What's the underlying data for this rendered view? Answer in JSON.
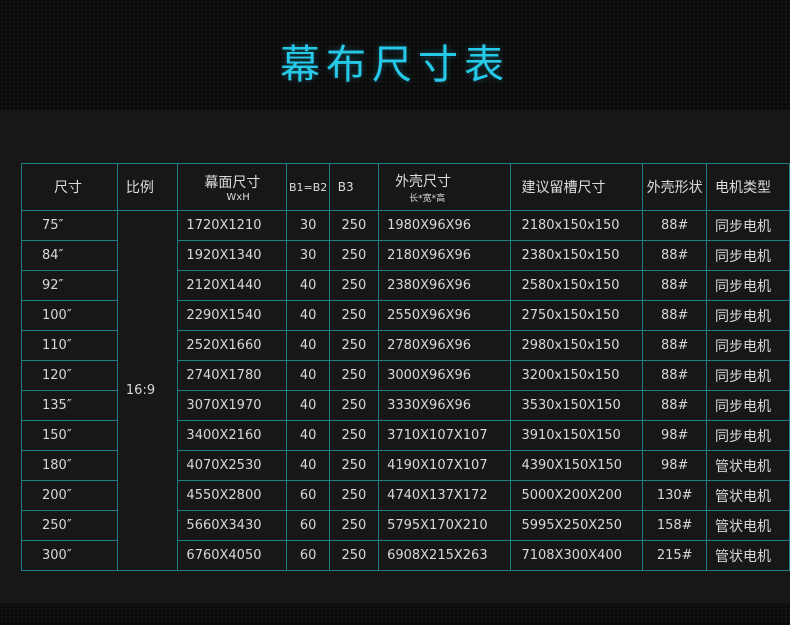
{
  "title": "幕布尺寸表",
  "headers": {
    "size": "尺寸",
    "ratio": "比例",
    "screen": "幕面尺寸",
    "screen_sub": "WxH",
    "b1b2": "B1=B2",
    "b3": "B3",
    "outer": "外壳尺寸",
    "outer_sub": "长*宽*高",
    "slot": "建议留槽尺寸",
    "shape": "外壳形状",
    "motor": "电机类型"
  },
  "ratio_value": "16:9",
  "rows": [
    {
      "size": "75″",
      "screen": "1720X1210",
      "b1b2": "30",
      "b3": "250",
      "outer": "1980X96X96",
      "slot": "2180x150x150",
      "shape": "88#",
      "motor": "同步电机"
    },
    {
      "size": "84″",
      "screen": "1920X1340",
      "b1b2": "30",
      "b3": "250",
      "outer": "2180X96X96",
      "slot": "2380x150x150",
      "shape": "88#",
      "motor": "同步电机"
    },
    {
      "size": "92″",
      "screen": "2120X1440",
      "b1b2": "40",
      "b3": "250",
      "outer": "2380X96X96",
      "slot": "2580x150x150",
      "shape": "88#",
      "motor": "同步电机"
    },
    {
      "size": "100″",
      "screen": "2290X1540",
      "b1b2": "40",
      "b3": "250",
      "outer": "2550X96X96",
      "slot": "2750x150x150",
      "shape": "88#",
      "motor": "同步电机"
    },
    {
      "size": "110″",
      "screen": "2520X1660",
      "b1b2": "40",
      "b3": "250",
      "outer": "2780X96X96",
      "slot": "2980x150x150",
      "shape": "88#",
      "motor": "同步电机"
    },
    {
      "size": "120″",
      "screen": "2740X1780",
      "b1b2": "40",
      "b3": "250",
      "outer": "3000X96X96",
      "slot": "3200x150x150",
      "shape": "88#",
      "motor": "同步电机"
    },
    {
      "size": "135″",
      "screen": "3070X1970",
      "b1b2": "40",
      "b3": "250",
      "outer": "3330X96X96",
      "slot": "3530x150X150",
      "shape": "88#",
      "motor": "同步电机"
    },
    {
      "size": "150″",
      "screen": "3400X2160",
      "b1b2": "40",
      "b3": "250",
      "outer": "3710X107X107",
      "slot": "3910x150X150",
      "shape": "98#",
      "motor": "同步电机"
    },
    {
      "size": "180″",
      "screen": "4070X2530",
      "b1b2": "40",
      "b3": "250",
      "outer": "4190X107X107",
      "slot": "4390X150X150",
      "shape": "98#",
      "motor": "管状电机"
    },
    {
      "size": "200″",
      "screen": "4550X2800",
      "b1b2": "60",
      "b3": "250",
      "outer": "4740X137X172",
      "slot": "5000X200X200",
      "shape": "130#",
      "motor": "管状电机"
    },
    {
      "size": "250″",
      "screen": "5660X3430",
      "b1b2": "60",
      "b3": "250",
      "outer": "5795X170X210",
      "slot": "5995X250X250",
      "shape": "158#",
      "motor": "管状电机"
    },
    {
      "size": "300″",
      "screen": "6760X4050",
      "b1b2": "60",
      "b3": "250",
      "outer": "6908X215X263",
      "slot": "7108X300X400",
      "shape": "215#",
      "motor": "管状电机"
    }
  ],
  "colors": {
    "title": "#27c9e8",
    "grid": "#1f7f86",
    "background": "#171717"
  }
}
